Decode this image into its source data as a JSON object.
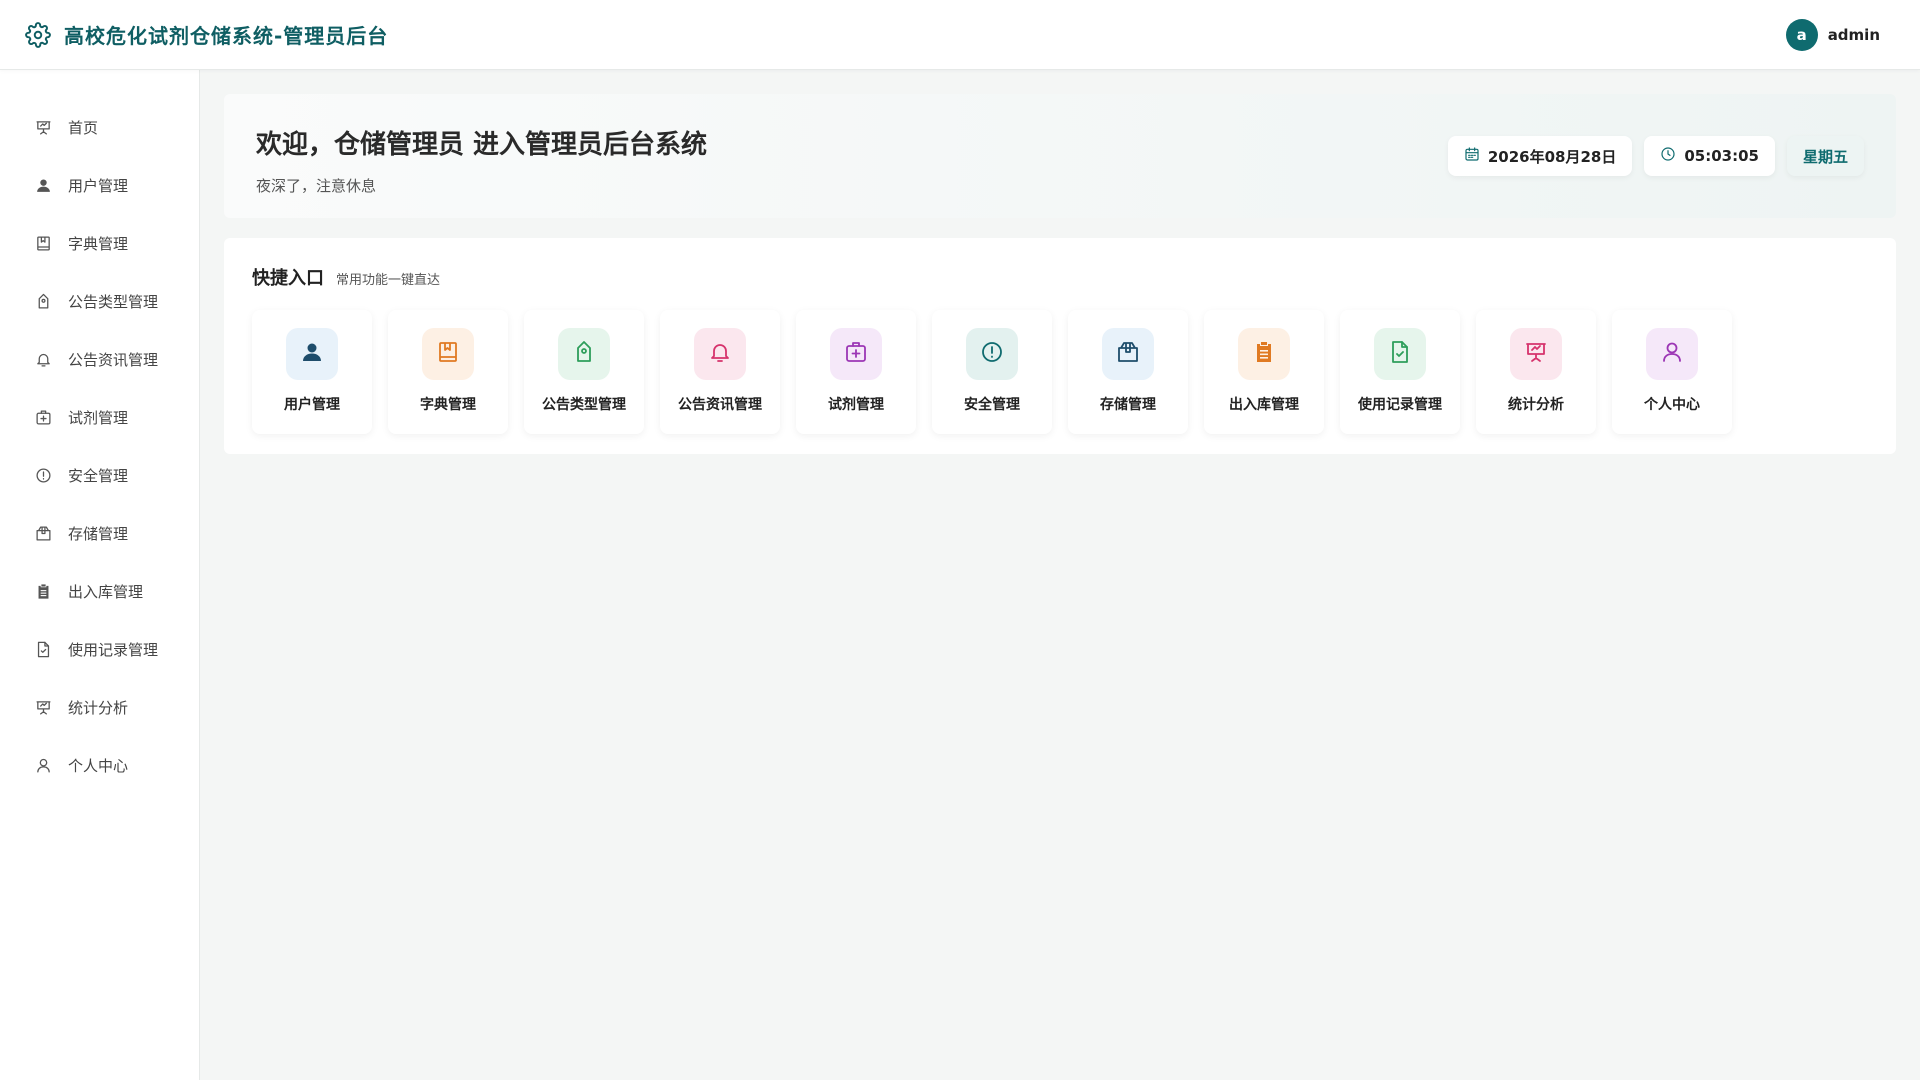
{
  "header": {
    "title": "高校危化试剂仓储系统-管理员后台",
    "logo_icon": "gear-icon",
    "brand_color": "#0f5e63",
    "user": {
      "avatar_letter": "a",
      "name": "admin"
    }
  },
  "sidebar": {
    "items": [
      {
        "label": "首页",
        "icon": "presentation-icon"
      },
      {
        "label": "用户管理",
        "icon": "user-icon"
      },
      {
        "label": "字典管理",
        "icon": "book-icon"
      },
      {
        "label": "公告类型管理",
        "icon": "tag-icon"
      },
      {
        "label": "公告资讯管理",
        "icon": "bell-icon"
      },
      {
        "label": "试剂管理",
        "icon": "medkit-icon"
      },
      {
        "label": "安全管理",
        "icon": "alert-icon"
      },
      {
        "label": "存储管理",
        "icon": "box-icon"
      },
      {
        "label": "出入库管理",
        "icon": "clipboard-icon"
      },
      {
        "label": "使用记录管理",
        "icon": "file-check-icon"
      },
      {
        "label": "统计分析",
        "icon": "presentation-icon"
      },
      {
        "label": "个人中心",
        "icon": "person-icon"
      }
    ]
  },
  "welcome": {
    "title": "欢迎，仓储管理员 进入管理员后台系统",
    "subtitle": "夜深了，注意休息",
    "date": "2026年08月28日",
    "time": "05:03:05",
    "weekday": "星期五"
  },
  "quick": {
    "title": "快捷入口",
    "subtitle": "常用功能一键直达",
    "cards": [
      {
        "label": "用户管理",
        "icon": "user-icon",
        "color": "#1e4d6b",
        "bg": "#e8f2fa"
      },
      {
        "label": "字典管理",
        "icon": "book-icon",
        "color": "#e07a22",
        "bg": "#fdf0e4"
      },
      {
        "label": "公告类型管理",
        "icon": "tag-icon",
        "color": "#2e9e5b",
        "bg": "#e6f5ec"
      },
      {
        "label": "公告资讯管理",
        "icon": "bell-icon",
        "color": "#d6336c",
        "bg": "#fbe7ee"
      },
      {
        "label": "试剂管理",
        "icon": "medkit-icon",
        "color": "#9c36b5",
        "bg": "#f5e8f9"
      },
      {
        "label": "安全管理",
        "icon": "alert-icon",
        "color": "#0f6b6f",
        "bg": "#e3f1ef"
      },
      {
        "label": "存储管理",
        "icon": "box-icon",
        "color": "#1e4d6b",
        "bg": "#e8f2fa"
      },
      {
        "label": "出入库管理",
        "icon": "clipboard-icon",
        "color": "#e07a22",
        "bg": "#fdf0e4"
      },
      {
        "label": "使用记录管理",
        "icon": "file-check-icon",
        "color": "#2e9e5b",
        "bg": "#e6f5ec"
      },
      {
        "label": "统计分析",
        "icon": "presentation-icon",
        "color": "#d6336c",
        "bg": "#fbe7ee"
      },
      {
        "label": "个人中心",
        "icon": "person-icon",
        "color": "#9c36b5",
        "bg": "#f5e8f9"
      }
    ]
  }
}
